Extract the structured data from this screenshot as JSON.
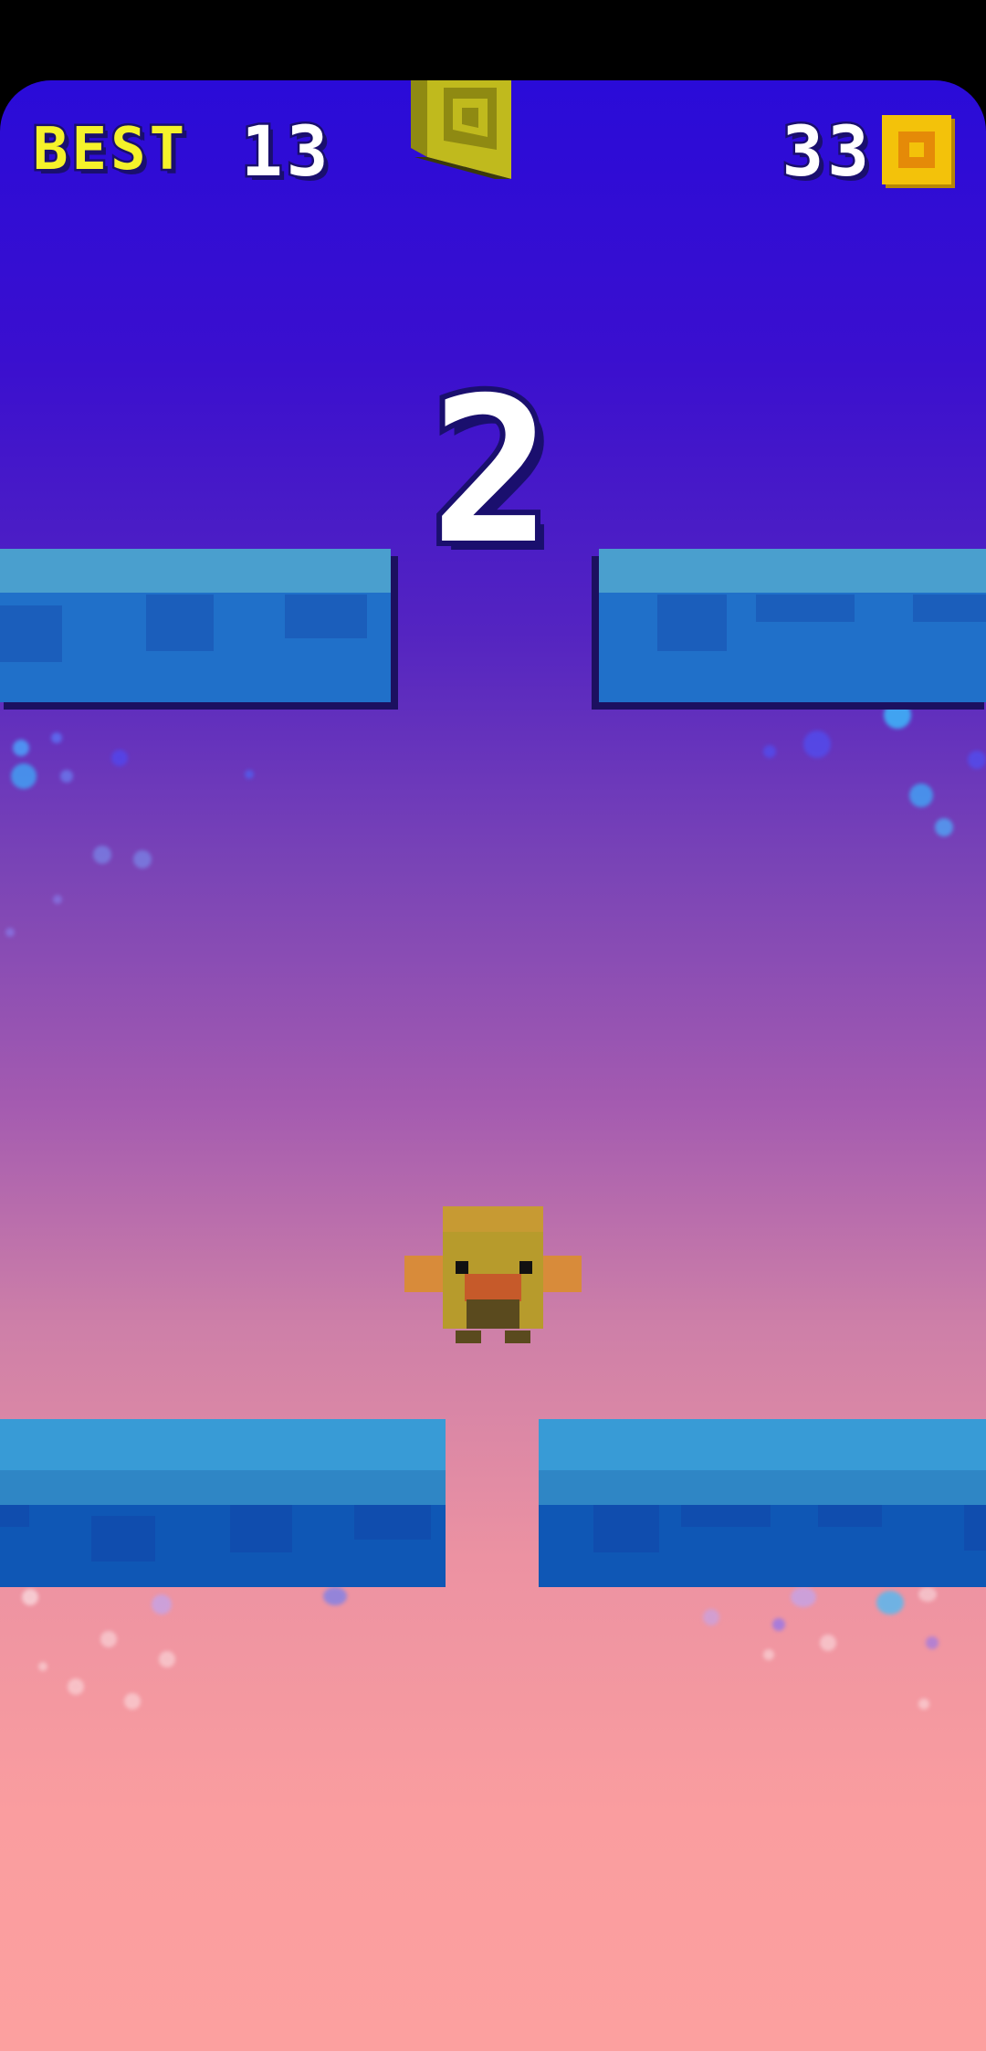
{
  "hud": {
    "best_label": "BEST",
    "best_value": "13",
    "coin_count": "33",
    "coin_icon": "coin-icon"
  },
  "score": "2",
  "colors": {
    "sky_top": "#2a0bd8",
    "sky_bottom": "#fca09f",
    "platform_top": "#4a9fce",
    "platform_front": "#2070c9",
    "best_label": "#f5f22a",
    "coin": "#f3c20a",
    "outline": "#1a0f6e"
  },
  "icons": {
    "falling_coin": "falling-coin-icon",
    "player": "chick-character-icon"
  }
}
